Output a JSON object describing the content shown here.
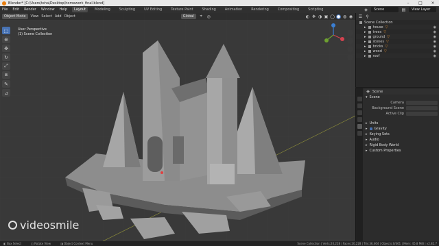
{
  "titlebar": {
    "title": "Blender* [C:\\Users\\teha\\Desktop\\homework_final.blend]"
  },
  "menubar": {
    "menus": [
      "File",
      "Edit",
      "Render",
      "Window",
      "Help"
    ],
    "workspaces": [
      "Layout",
      "Modeling",
      "Sculpting",
      "UV Editing",
      "Texture Paint",
      "Shading",
      "Animation",
      "Rendering",
      "Compositing",
      "Scripting"
    ],
    "active_workspace": "Layout",
    "scene": "Scene",
    "view_layer": "View Layer"
  },
  "viewport": {
    "mode": "Object Mode",
    "menus": [
      "View",
      "Select",
      "Add",
      "Object"
    ],
    "orientation": "Global",
    "perspective": "User Perspective",
    "collection": "(1) Scene Collection"
  },
  "outliner": {
    "root": "Scene Collection",
    "items": [
      "house",
      "trees",
      "ground",
      "stones",
      "bricks",
      "wood",
      "roof"
    ]
  },
  "properties": {
    "header": "Scene",
    "section": "Scene",
    "fields": [
      "Camera",
      "Background Scene",
      "Active Clip"
    ],
    "units": "Units",
    "gravity": "Gravity",
    "collapsed": [
      "Keying Sets",
      "Audio",
      "Rigid Body World",
      "Custom Properties"
    ]
  },
  "watermark": "videosmile",
  "statusbar": {
    "select": "Box Select",
    "rotate": "Rotate View",
    "menu": "Object Context Menu",
    "stats": "Scene Collection | Verts:20,228 | Faces:20,228 | Tris:36,464 | Objects:0/461 | Mem: 45.8 MiB | v2.82.7"
  },
  "colors": {
    "accent": "#4772b3",
    "icon_orange": "#e08a2c",
    "viewport_bg": "#393939"
  }
}
